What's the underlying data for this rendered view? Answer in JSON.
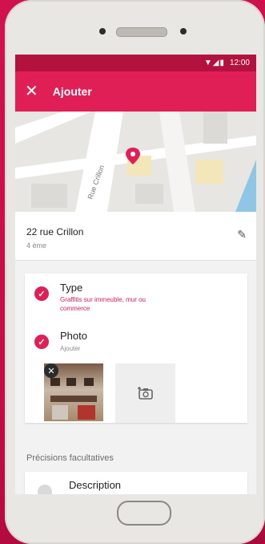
{
  "statusbar": {
    "icons": "▼◢▮",
    "time": "12:00"
  },
  "appbar": {
    "close_icon": "✕",
    "title": "Ajouter"
  },
  "map": {
    "street_label": "Rue Crillon"
  },
  "address": {
    "street": "22 rue Crillon",
    "floor": "4 ème",
    "edit_icon": "✎"
  },
  "type_row": {
    "check": "✓",
    "label": "Type",
    "value_line1": "Graffitis sur immeuble, mur ou",
    "value_line2": "commerce"
  },
  "photo_row": {
    "check": "✓",
    "label": "Photo",
    "action": "Ajouter",
    "remove_icon": "✕"
  },
  "optional": {
    "heading": "Précisions facultatives",
    "description_label": "Description"
  },
  "colors": {
    "accent": "#e01f56",
    "statusbar": "#b3123f"
  }
}
